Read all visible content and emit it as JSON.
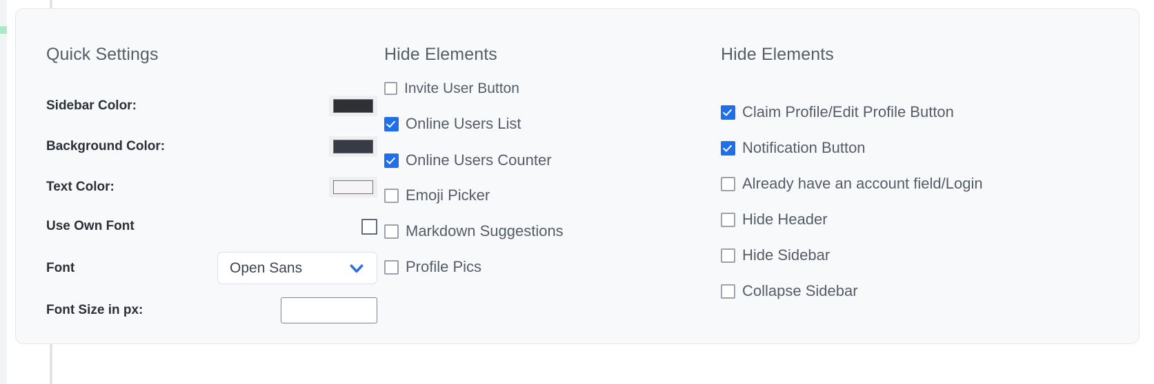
{
  "quick_settings": {
    "title": "Quick Settings",
    "rows": [
      {
        "label": "Sidebar Color:",
        "control": "color",
        "value": "#2e3036"
      },
      {
        "label": "Background Color:",
        "control": "color",
        "value": "#363b45"
      },
      {
        "label": "Text Color:",
        "control": "color",
        "value": "#f7f4f6"
      },
      {
        "label": "Use Own Font",
        "control": "checkbox",
        "checked": false
      },
      {
        "label": "Font",
        "control": "select",
        "value": "Open Sans"
      },
      {
        "label": "Font Size in px:",
        "control": "text",
        "value": "",
        "placeholder": ""
      }
    ]
  },
  "hide_elements_mid": {
    "title": "Hide Elements",
    "items": [
      {
        "label": "Invite User Button",
        "checked": false
      },
      {
        "label": "Online Users List",
        "checked": true
      },
      {
        "label": "Online Users Counter",
        "checked": true
      },
      {
        "label": "Emoji Picker",
        "checked": false
      },
      {
        "label": "Markdown Suggestions",
        "checked": false
      },
      {
        "label": "Profile Pics",
        "checked": false
      }
    ]
  },
  "hide_elements_right": {
    "title": "Hide Elements",
    "items": [
      {
        "label": "Claim Profile/Edit Profile Button",
        "checked": true
      },
      {
        "label": "Notification Button",
        "checked": true
      },
      {
        "label": "Already have an account field/Login",
        "checked": false
      },
      {
        "label": "Hide Header",
        "checked": false
      },
      {
        "label": "Hide Sidebar",
        "checked": false
      },
      {
        "label": "Collapse Sidebar",
        "checked": false
      }
    ]
  },
  "colors": {
    "accent_blue": "#1f6feb",
    "panel_bg": "#f8f9fb",
    "panel_border": "#e4e6ea",
    "left_accent": "#a9e9c8"
  }
}
